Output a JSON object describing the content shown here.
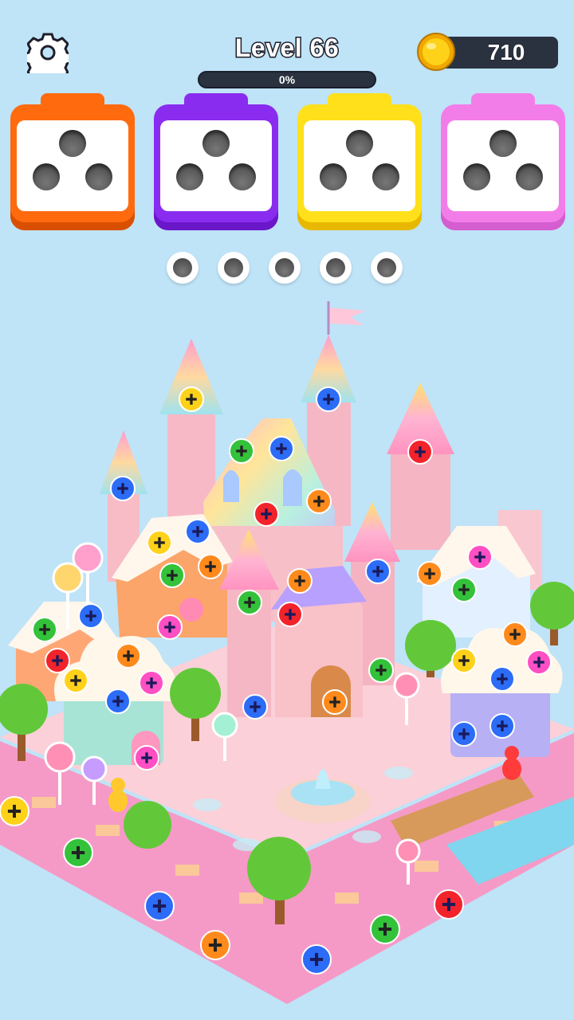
{
  "header": {
    "level_label": "Level 66",
    "progress_percent": 0,
    "progress_text": "0%",
    "coins": "710"
  },
  "icons": {
    "settings": "gear-icon",
    "coin": "coin-icon",
    "screw": "cross-screw-icon"
  },
  "colors": {
    "background": "#bfe3f7",
    "hud_dark": "#2a3240",
    "orange": "#ff6a0f",
    "purple": "#8a2cf0",
    "yellow": "#ffe01a",
    "pink": "#f37de8",
    "screw_yellow": "#ffd21a",
    "screw_green": "#33c23a",
    "screw_red": "#f2232b",
    "screw_blue": "#2c6cf6",
    "screw_orange": "#ff8a1c",
    "screw_pink": "#ff4fc3"
  },
  "boxes": [
    {
      "color": "orange",
      "holes": 3,
      "filled": 0
    },
    {
      "color": "purple",
      "holes": 3,
      "filled": 0
    },
    {
      "color": "yellow",
      "holes": 3,
      "filled": 0
    },
    {
      "color": "pink",
      "holes": 3,
      "filled": 0
    }
  ],
  "buffer_slots": {
    "total": 5,
    "filled": 0
  }
}
